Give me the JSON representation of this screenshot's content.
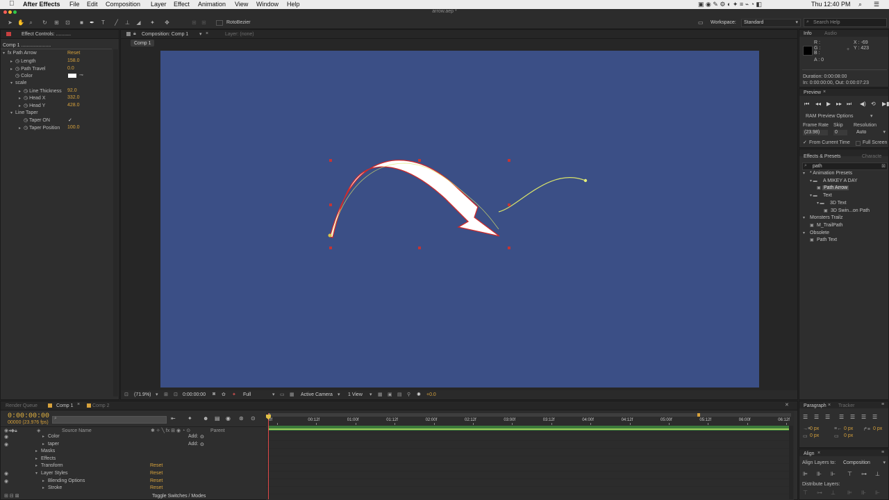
{
  "menubar": {
    "apple": "",
    "app": "After Effects",
    "items": [
      "File",
      "Edit",
      "Composition",
      "Layer",
      "Effect",
      "Animation",
      "View",
      "Window",
      "Help"
    ],
    "clock": "Thu 12:40 PM"
  },
  "window": {
    "title": "arrow.aep *"
  },
  "toolbar": {
    "rotobezier": "RotoBezier",
    "workspace_label": "Workspace:",
    "workspace_value": "Standard",
    "search_placeholder": "Search Help"
  },
  "effect_controls": {
    "tab": "Effect Controls: ...........",
    "layer": "Comp 1 ......................",
    "effect_name": "Path Arrow",
    "reset": "Reset",
    "props": [
      {
        "label": "Length",
        "value": "158.0"
      },
      {
        "label": "Path Travel",
        "value": "0.0"
      },
      {
        "label": "Color",
        "value": ""
      }
    ],
    "group_scale": "scale",
    "scale_props": [
      {
        "label": "Line Thickness",
        "value": "92.0"
      },
      {
        "label": "Head X",
        "value": "332.0"
      },
      {
        "label": "Head Y",
        "value": "428.0"
      }
    ],
    "group_taper": "Line Taper",
    "taper_props": [
      {
        "label": "Taper ON",
        "value": "✓"
      },
      {
        "label": "Taper Position",
        "value": "100.0"
      }
    ]
  },
  "composition": {
    "tab": "Composition: Comp 1",
    "layer_tab": "Layer: (none)",
    "subtab": "Comp 1",
    "bg_color": "#3b4f86",
    "bottom": {
      "zoom": "(71.9%)",
      "time": "0:00:00:00",
      "resolution": "Full",
      "camera": "Active Camera",
      "view": "1 View",
      "exposure": "+0.0"
    }
  },
  "info": {
    "tab": "Info",
    "tab2": "Audio",
    "r": "R :",
    "g": "G :",
    "b": "B :",
    "a": "A : 0",
    "x": "X : -69",
    "y": "Y : 423",
    "duration": "Duration: 0:00:08:00",
    "inout": "In: 0:00:00:00, Out: 0:00:07:23"
  },
  "preview": {
    "tab": "Preview",
    "ram": "RAM Preview Options",
    "frame_rate_label": "Frame Rate",
    "skip_label": "Skip",
    "resolution_label": "Resolution",
    "frame_rate": "(23.98)",
    "skip": "0",
    "resolution": "Auto",
    "from_current": "From Current Time",
    "full_screen": "Full Screen"
  },
  "effects_presets": {
    "tab": "Effects & Presets",
    "tab2": "Characte",
    "search": "path",
    "tree": [
      {
        "label": "* Animation Presets",
        "indent": 0,
        "type": "group"
      },
      {
        "label": "A MIKEY A DAY",
        "indent": 1,
        "type": "folder"
      },
      {
        "label": "Path Arrow",
        "indent": 2,
        "type": "preset",
        "selected": true
      },
      {
        "label": "Text",
        "indent": 1,
        "type": "folder"
      },
      {
        "label": "3D Text",
        "indent": 2,
        "type": "folder"
      },
      {
        "label": "3D Swin...on Path",
        "indent": 3,
        "type": "preset"
      },
      {
        "label": "Monsters Trailz",
        "indent": 0,
        "type": "group"
      },
      {
        "label": "M_TrailPath",
        "indent": 1,
        "type": "preset"
      },
      {
        "label": "Obsolete",
        "indent": 0,
        "type": "group"
      },
      {
        "label": "Path Text",
        "indent": 1,
        "type": "preset"
      }
    ]
  },
  "timeline": {
    "tabs": [
      "Render Queue",
      "Comp 1",
      "Comp 2"
    ],
    "timecode": "0:00:00:00",
    "fps": "00000 (23.976 fps)",
    "col_source": "Source Name",
    "col_parent": "Parent",
    "ruler": [
      "0f",
      "00:12f",
      "01:00f",
      "01:12f",
      "02:00f",
      "02:12f",
      "03:00f",
      "03:12f",
      "04:00f",
      "04:12f",
      "05:00f",
      "05:12f",
      "06:00f",
      "06:12f"
    ],
    "rows": [
      {
        "label": "Color",
        "indent": 3,
        "extra": "Add:"
      },
      {
        "label": "taper",
        "indent": 3,
        "extra": "Add:"
      },
      {
        "label": "Masks",
        "indent": 2,
        "extra": ""
      },
      {
        "label": "Effects",
        "indent": 2,
        "extra": ""
      },
      {
        "label": "Transform",
        "indent": 2,
        "extra": "Reset"
      },
      {
        "label": "Layer Styles",
        "indent": 2,
        "extra": "Reset"
      },
      {
        "label": "Blending Options",
        "indent": 3,
        "extra": "Reset"
      },
      {
        "label": "Stroke",
        "indent": 3,
        "extra": "Reset"
      }
    ],
    "toggle": "Toggle Switches / Modes"
  },
  "paragraph": {
    "tab": "Paragraph",
    "tab2": "Tracker",
    "px1": "0 px",
    "px2": "0 px",
    "px3": "0 px",
    "px4": "0 px",
    "px5": "0 px"
  },
  "align": {
    "tab": "Align",
    "layers_to_label": "Align Layers to:",
    "layers_to": "Composition",
    "distribute": "Distribute Layers:"
  },
  "colors": {
    "accent": "#d7a23c",
    "comp_bg": "#3b4f86",
    "arrow_outline": "#d02b2b",
    "path": "#d9e36a"
  }
}
